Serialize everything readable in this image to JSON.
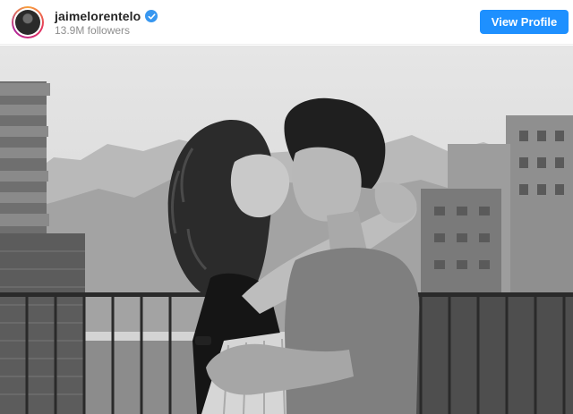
{
  "profile": {
    "username": "jaimelorentelo",
    "followers": "13.9M followers",
    "verified": true
  },
  "actions": {
    "view_profile_label": "View Profile"
  },
  "colors": {
    "accent": "#1e90ff",
    "verified_badge": "#3897f0"
  },
  "icons": {
    "verified": "verified-badge-icon",
    "avatar": "profile-avatar"
  },
  "photo": {
    "style": "black-and-white"
  }
}
